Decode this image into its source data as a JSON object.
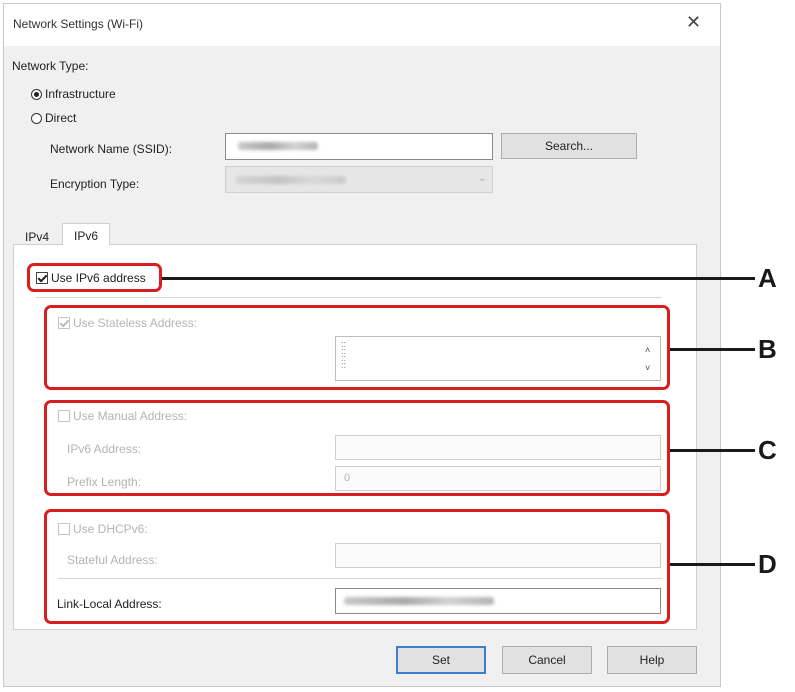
{
  "dialog": {
    "title": "Network Settings (Wi-Fi)",
    "close_label": "✕"
  },
  "network_type": {
    "label": "Network Type:",
    "infrastructure": "Infrastructure",
    "direct": "Direct",
    "selected": "Infrastructure"
  },
  "ssid": {
    "label": "Network Name (SSID):",
    "search_label": "Search..."
  },
  "encryption": {
    "label": "Encryption Type:"
  },
  "tabs": [
    {
      "label": "IPv4",
      "active": false
    },
    {
      "label": "IPv6",
      "active": true
    }
  ],
  "ipv6": {
    "use_ipv6_label": "Use IPv6 address",
    "use_ipv6_checked": true,
    "stateless_label": "Use Stateless Address:",
    "stateless_checked": true,
    "manual_label": "Use Manual Address:",
    "manual_checked": false,
    "ipv6_address_label": "IPv6 Address:",
    "prefix_length_label": "Prefix Length:",
    "prefix_length_value": "0",
    "dhcpv6_label": "Use DHCPv6:",
    "dhcpv6_checked": false,
    "stateful_label": "Stateful Address:",
    "link_local_label": "Link-Local Address:"
  },
  "buttons": {
    "set": "Set",
    "cancel": "Cancel",
    "help": "Help"
  },
  "annotations": {
    "A": "A",
    "B": "B",
    "C": "C",
    "D": "D",
    "color": "#d81e1e"
  },
  "icons": {
    "scroll_up": "˄",
    "scroll_down": "˅",
    "dropdown": "⌄"
  }
}
